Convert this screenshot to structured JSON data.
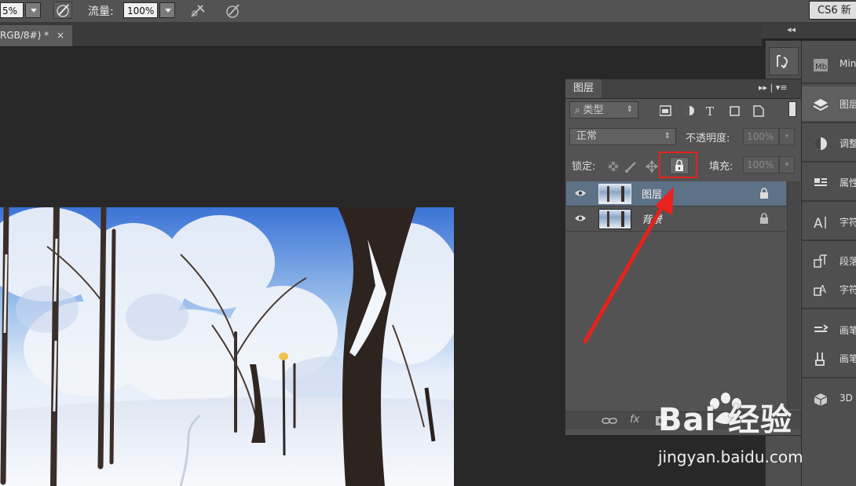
{
  "optbar": {
    "zoom_partial": "5%",
    "flow_label": "流量:",
    "flow_value": "100%",
    "workspace_button": "CS6 新"
  },
  "document": {
    "tab_title": "RGB/8#) *",
    "close_glyph": "×"
  },
  "dock": {
    "collapse_glyph": "◂◂",
    "items": [
      {
        "label": "Min",
        "icon": "mini-bridge-icon"
      },
      {
        "label": "图层",
        "icon": "layers-icon"
      },
      {
        "label": "调整",
        "icon": "adjustments-icon"
      },
      {
        "label": "属性",
        "icon": "properties-icon"
      },
      {
        "label": "字符",
        "icon": "character-icon"
      },
      {
        "label": "段落",
        "icon": "paragraph-icon"
      },
      {
        "label": "字符",
        "icon": "character-styles-icon"
      },
      {
        "label": "画笔",
        "icon": "brush-icon"
      },
      {
        "label": "画笔",
        "icon": "brush-presets-icon"
      },
      {
        "label": "3D",
        "icon": "3d-icon"
      }
    ]
  },
  "layers_panel": {
    "tab_label": "图层",
    "menu_glyph": "▸▸ | ▾≡",
    "filter_kind": "类型",
    "blend_mode": "正常",
    "opacity_label": "不透明度:",
    "opacity_value": "100%",
    "lock_label": "锁定:",
    "fill_label": "填充:",
    "fill_value": "100%",
    "layers": [
      {
        "name": "图层",
        "selected": true
      },
      {
        "name": "背景",
        "selected": false
      }
    ],
    "footer_fx": "fx"
  },
  "watermark": {
    "brand": "Bai 经验",
    "url": "jingyan.baidu.com"
  },
  "colors": {
    "annotation_red": "#e8221c",
    "selected_row": "#5d7187"
  }
}
